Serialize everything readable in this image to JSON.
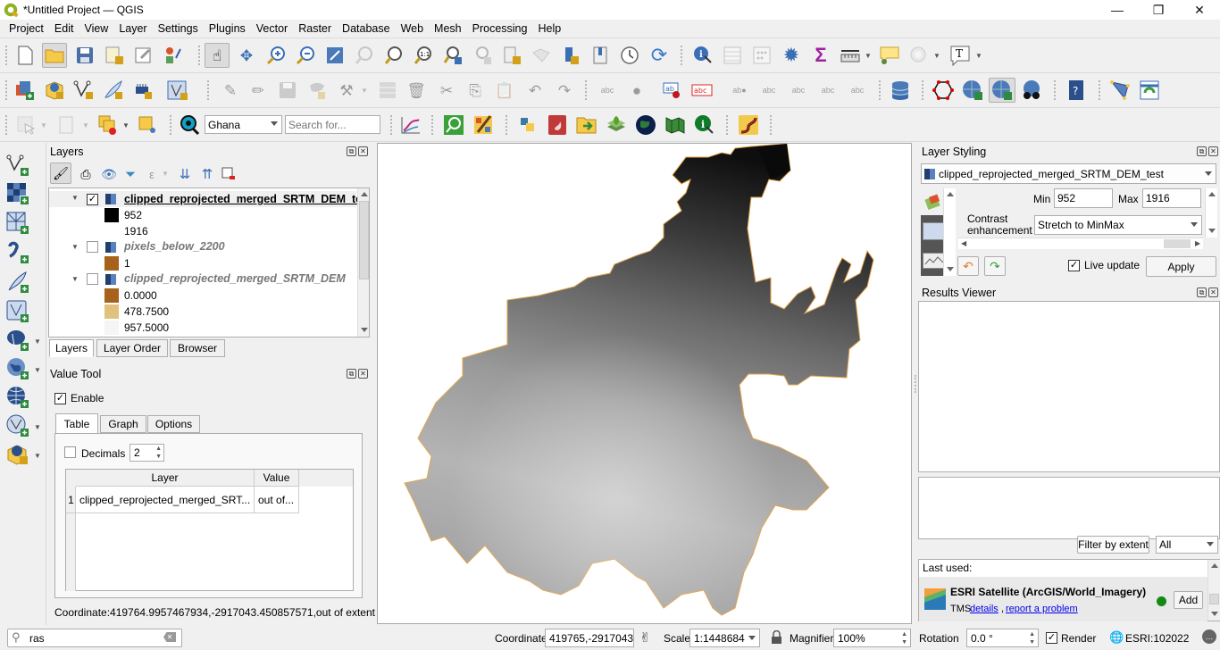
{
  "window": {
    "title": "*Untitled Project — QGIS",
    "controls": {
      "minimize": "—",
      "restore": "❐",
      "close": "✕"
    }
  },
  "menu": [
    "Project",
    "Edit",
    "View",
    "Layer",
    "Settings",
    "Plugins",
    "Vector",
    "Raster",
    "Database",
    "Web",
    "Mesh",
    "Processing",
    "Help"
  ],
  "toolbar_row1": [
    "new-project-icon",
    "open-project-icon",
    "save-project-icon",
    "new-print-layout-icon",
    "layout-manager-icon",
    "style-manager-icon",
    "pan-icon",
    "pan-to-selection-icon",
    "zoom-in-icon",
    "zoom-out-icon",
    "zoom-full-icon",
    "zoom-to-selection-icon",
    "zoom-to-layer-icon",
    "zoom-native-icon",
    "zoom-last-icon",
    "zoom-next-icon",
    "new-bookmark-icon",
    "show-bookmarks-icon",
    "temporal-controller-icon",
    "refresh-icon",
    "identify-icon",
    "open-attribute-table-icon",
    "field-calculator-icon",
    "processing-toolbox-icon",
    "statistics-icon",
    "measure-icon",
    "map-tips-icon",
    "annotation-icon",
    "text-annotation-icon"
  ],
  "toolbar_row2": [
    "data-source-manager-icon",
    "new-geopackage-icon",
    "new-shapefile-icon",
    "new-temporary-layer-icon",
    "new-virtual-layer-icon",
    "new-mesh-layer-icon",
    "current-edits-icon",
    "toggle-editing-icon",
    "save-edits-icon",
    "add-feature-icon",
    "vertex-tool-icon",
    "modify-attributes-icon",
    "delete-selected-icon",
    "cut-features-icon",
    "copy-features-icon",
    "paste-features-icon",
    "undo-icon",
    "redo-icon",
    "label-toolbar-icon",
    "diagram-icon",
    "layer-labeling-icon",
    "layer-diagram-icon",
    "pin-labels-icon",
    "show-hide-labels-icon",
    "move-label-icon",
    "rotate-label-icon",
    "change-label-icon",
    "db-manager-icon",
    "topology-checker-icon",
    "quickmapservices-icon",
    "quickmapservices-search-icon",
    "metasearch-icon",
    "help-icon",
    "georeferencer-icon",
    "refresh-table-icon"
  ],
  "toolbar_row3": {
    "locator_combo": "Ghana",
    "search_placeholder": "Search for...",
    "icons": [
      "select-features-icon",
      "deselect-icon",
      "select-by-location-icon",
      "identify-locator-icon",
      "profile-tool-icon",
      "qgis-search-icon",
      "color-picker-icon",
      "python-console-icon",
      "plugin-red-icon",
      "import-export-icon",
      "layers-stack-icon",
      "globe-icon",
      "map-swipe-icon",
      "identify-plus-icon",
      "vectorbender-icon"
    ]
  },
  "layers_panel": {
    "title": "Layers",
    "tabs": [
      "Layers",
      "Layer Order",
      "Browser"
    ],
    "layers": [
      {
        "name": "clipped_reprojected_merged_SRTM_DEM_test",
        "checked": true,
        "active": true,
        "legend": [
          {
            "label": "952",
            "color": "#000000"
          },
          {
            "label": "1916",
            "color": "#ffffff"
          }
        ]
      },
      {
        "name": "pixels_below_2200",
        "checked": false,
        "active": false,
        "legend": [
          {
            "label": "1",
            "color": "#a6611a"
          }
        ]
      },
      {
        "name": "clipped_reprojected_merged_SRTM_DEM",
        "checked": false,
        "active": false,
        "legend": [
          {
            "label": "0.0000",
            "color": "#a6611a"
          },
          {
            "label": "478.7500",
            "color": "#dfc27d"
          },
          {
            "label": "957.5000",
            "color": "#f5f5f5"
          }
        ]
      }
    ]
  },
  "value_tool": {
    "title": "Value Tool",
    "enable_label": "Enable",
    "enabled": true,
    "tabs": [
      "Table",
      "Graph",
      "Options"
    ],
    "decimals_label": "Decimals",
    "decimals_checked": false,
    "decimals_value": "2",
    "table_headers": [
      "Layer",
      "Value"
    ],
    "rows": [
      {
        "index": "1",
        "layer": "clipped_reprojected_merged_SRT...",
        "value": "out of..."
      }
    ],
    "coordinate_text": "Coordinate:419764.9957467934,-2917043.450857571,out of extent"
  },
  "locator_search": {
    "value": "ras"
  },
  "layer_styling": {
    "title": "Layer Styling",
    "layer_combo": "clipped_reprojected_merged_SRTM_DEM_test",
    "min_label": "Min",
    "min_value": "952",
    "max_label": "Max",
    "max_value": "1916",
    "contrast_label": "Contrast enhancement",
    "contrast_value": "Stretch to MinMax",
    "live_update_label": "Live update",
    "live_update": true,
    "apply_label": "Apply"
  },
  "results_viewer": {
    "title": "Results Viewer"
  },
  "quickmapservices": {
    "filter_button": "Filter by extent",
    "filter_combo": "All",
    "last_used_label": "Last used:",
    "service_name": "ESRI Satellite (ArcGIS/World_Imagery)",
    "service_type": "TMS",
    "details_link": "details",
    "report_link": "report a problem",
    "add_button": "Add",
    "status_color": "#138a13"
  },
  "statusbar": {
    "coordinate_label": "Coordinate",
    "coordinate_value": "419765,-2917043",
    "scale_label": "Scale",
    "scale_value": "1:1448684",
    "magnifier_label": "Magnifier",
    "magnifier_value": "100%",
    "rotation_label": "Rotation",
    "rotation_value": "0.0 °",
    "render_label": "Render",
    "render_checked": true,
    "crs_label": "ESRI:102022"
  }
}
